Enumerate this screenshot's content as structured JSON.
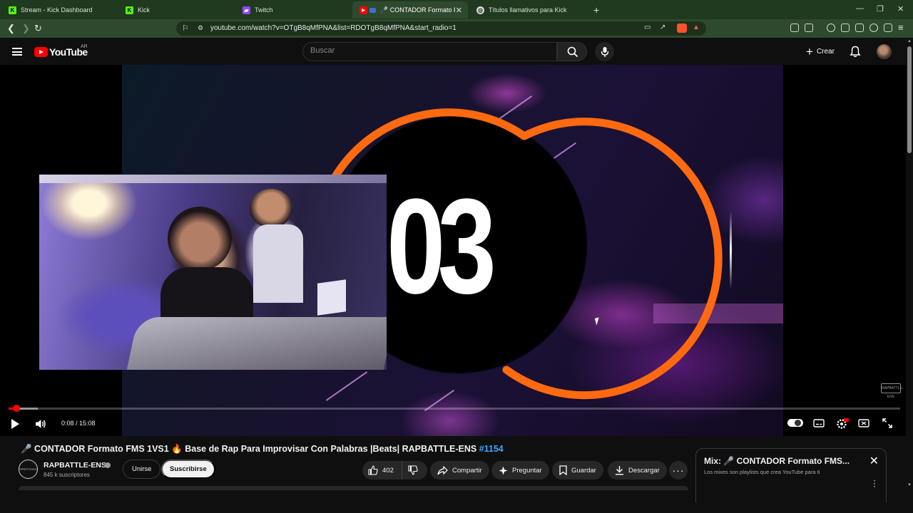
{
  "browser": {
    "tabs": [
      {
        "label": "Stream - Kick Dashboard",
        "favicon": "kick-icon"
      },
      {
        "label": "Kick",
        "favicon": "kick-icon"
      },
      {
        "label": "Twitch",
        "favicon": "twitch-icon"
      },
      {
        "label": "🎤 CONTADOR Formato FMS",
        "favicon": "youtube-icon",
        "active": true
      },
      {
        "label": "Títulos llamativos para Kick",
        "favicon": "chatgpt-icon"
      }
    ],
    "new_tab": "+",
    "url": "youtube.com/watch?v=OTgB8qMfPNA&list=RDOTgB8qMfPNA&start_radio=1"
  },
  "youtube": {
    "logo_text": "YouTube",
    "country_code": "AR",
    "search_placeholder": "Buscar",
    "create_label": "Crear"
  },
  "player": {
    "counter_text": "03",
    "watermark": "RAPBATTLE-ENS",
    "current_time": "0:08",
    "duration": "15:08",
    "time_display": "0:08 / 15:08",
    "progress_fraction": 0.009,
    "buffer_fraction": 0.033
  },
  "video": {
    "title_text": "🎤 CONTADOR Formato FMS 1VS1 🔥 Base de Rap Para Improvisar Con Palabras |Beats| RAPBATTLE-ENS ",
    "title_hashtag": "#1154",
    "channel_name": "RAPBATTLE-ENS",
    "subscribers": "845 k suscriptores",
    "join_label": "Unirse",
    "subscribe_label": "Suscribirse",
    "like_count": "402",
    "share_label": "Compartir",
    "ask_label": "Preguntar",
    "save_label": "Guardar",
    "download_label": "Descargar"
  },
  "mix": {
    "title": "Mix: 🎤 CONTADOR Formato FMS...",
    "subtitle": "Los mixes son playlists que crea YouTube para ti"
  },
  "colors": {
    "browser_frame": "#2e4a2e",
    "youtube_red": "#ff0000",
    "ring_orange": "#ff6a10",
    "hashtag_blue": "#3ea6ff"
  }
}
